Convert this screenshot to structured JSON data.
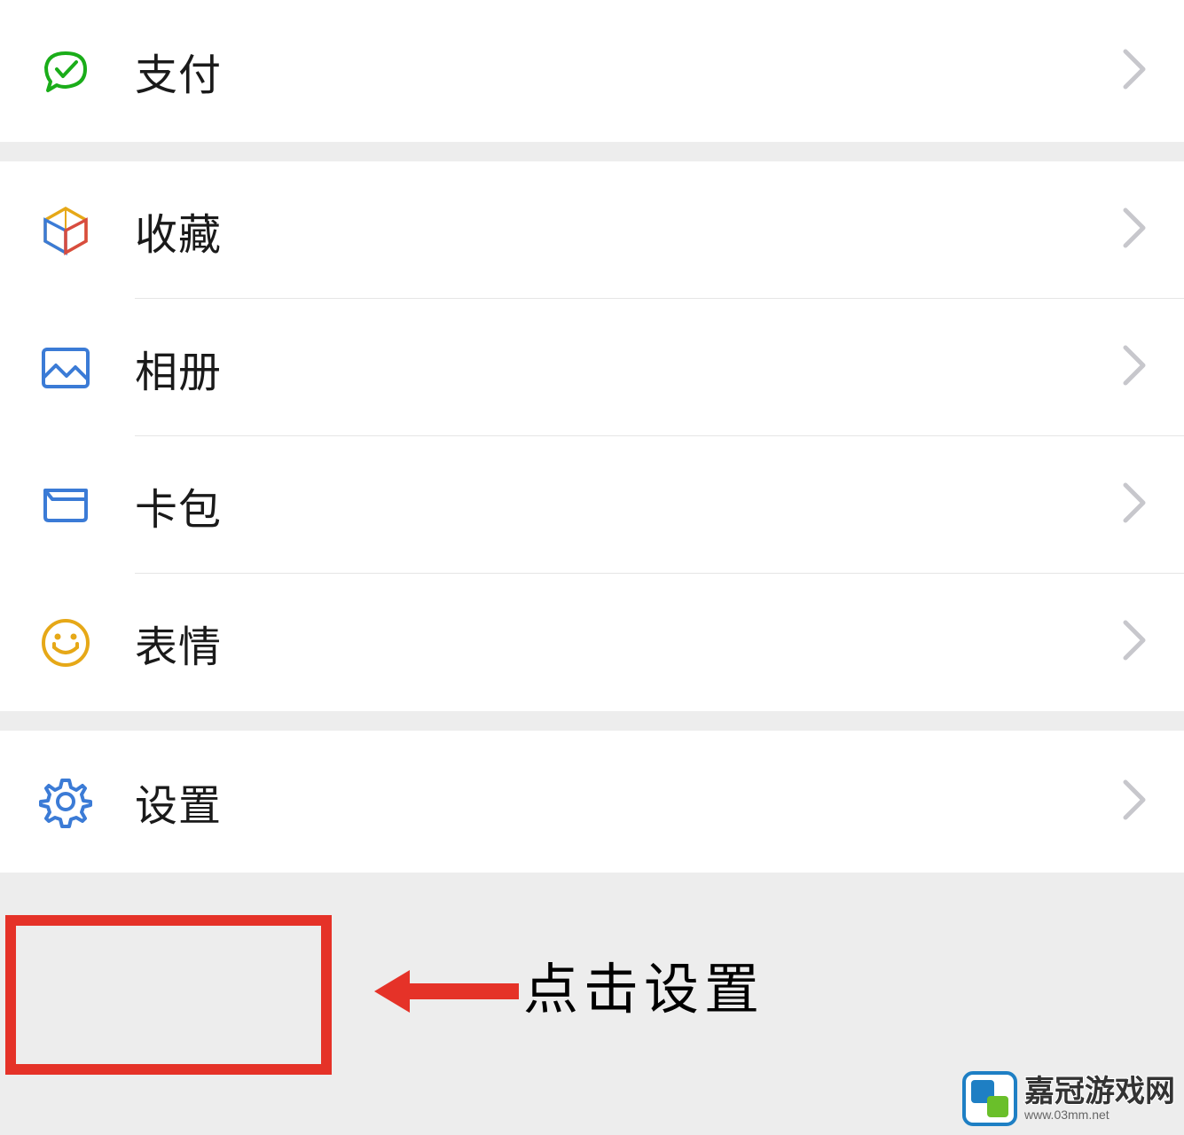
{
  "menu": {
    "pay": "支付",
    "favorites": "收藏",
    "album": "相册",
    "cards": "卡包",
    "stickers": "表情",
    "settings": "设置"
  },
  "annotation": {
    "text": "点击设置"
  },
  "watermark": {
    "main": "嘉冠游戏网",
    "sub": "www.03mm.net"
  }
}
